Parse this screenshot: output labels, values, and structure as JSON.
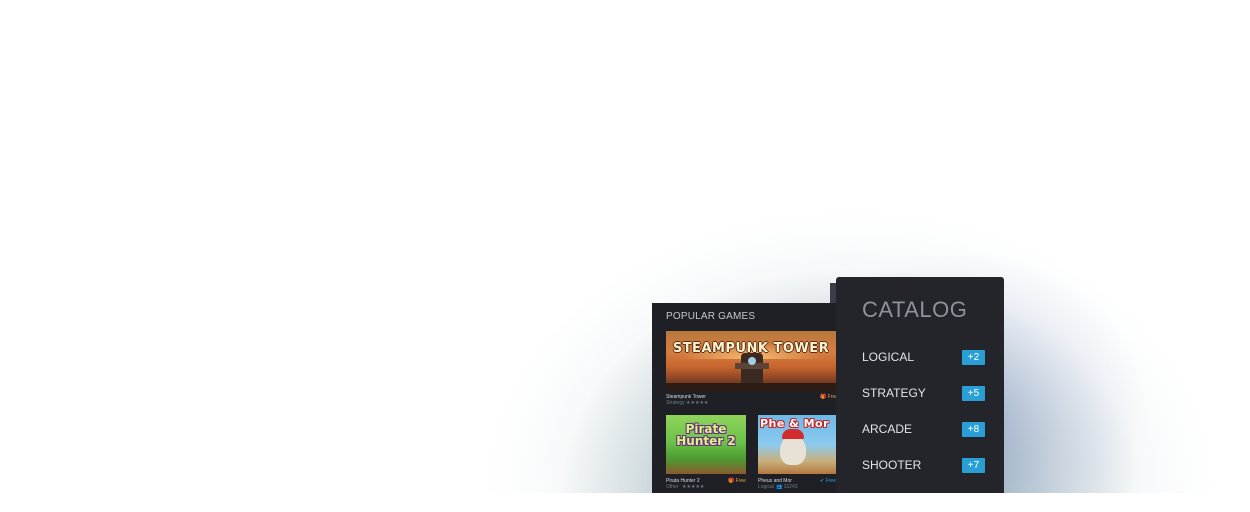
{
  "popular": {
    "title": "POPULAR GAMES",
    "featured": {
      "banner_text": "STEAMPUNK TOWER",
      "name": "Steampunk Tower",
      "category": "Strategy",
      "rating": "★★★★★",
      "price": "🎁 Free"
    },
    "items": [
      {
        "image_text": "Pirate Hunter 2",
        "name": "Pirata Hunter 2",
        "category": "Other",
        "rating": "★★★★★",
        "price": "🎁 Free"
      },
      {
        "image_text": "Phe & Mor",
        "name": "Pheus and Mor",
        "category": "Logical",
        "downloads": "👥 16243",
        "price": "✔ Free"
      }
    ]
  },
  "catalog": {
    "title": "CATALOG",
    "items": [
      {
        "label": "LOGICAL",
        "badge": "+2"
      },
      {
        "label": "STRATEGY",
        "badge": "+5"
      },
      {
        "label": "ARCADE",
        "badge": "+8"
      },
      {
        "label": "SHOOTER",
        "badge": "+7"
      }
    ]
  },
  "colors": {
    "accent": "#2a9fd6",
    "panel_bg": "#23252b",
    "free_gold": "#e0a33a"
  }
}
